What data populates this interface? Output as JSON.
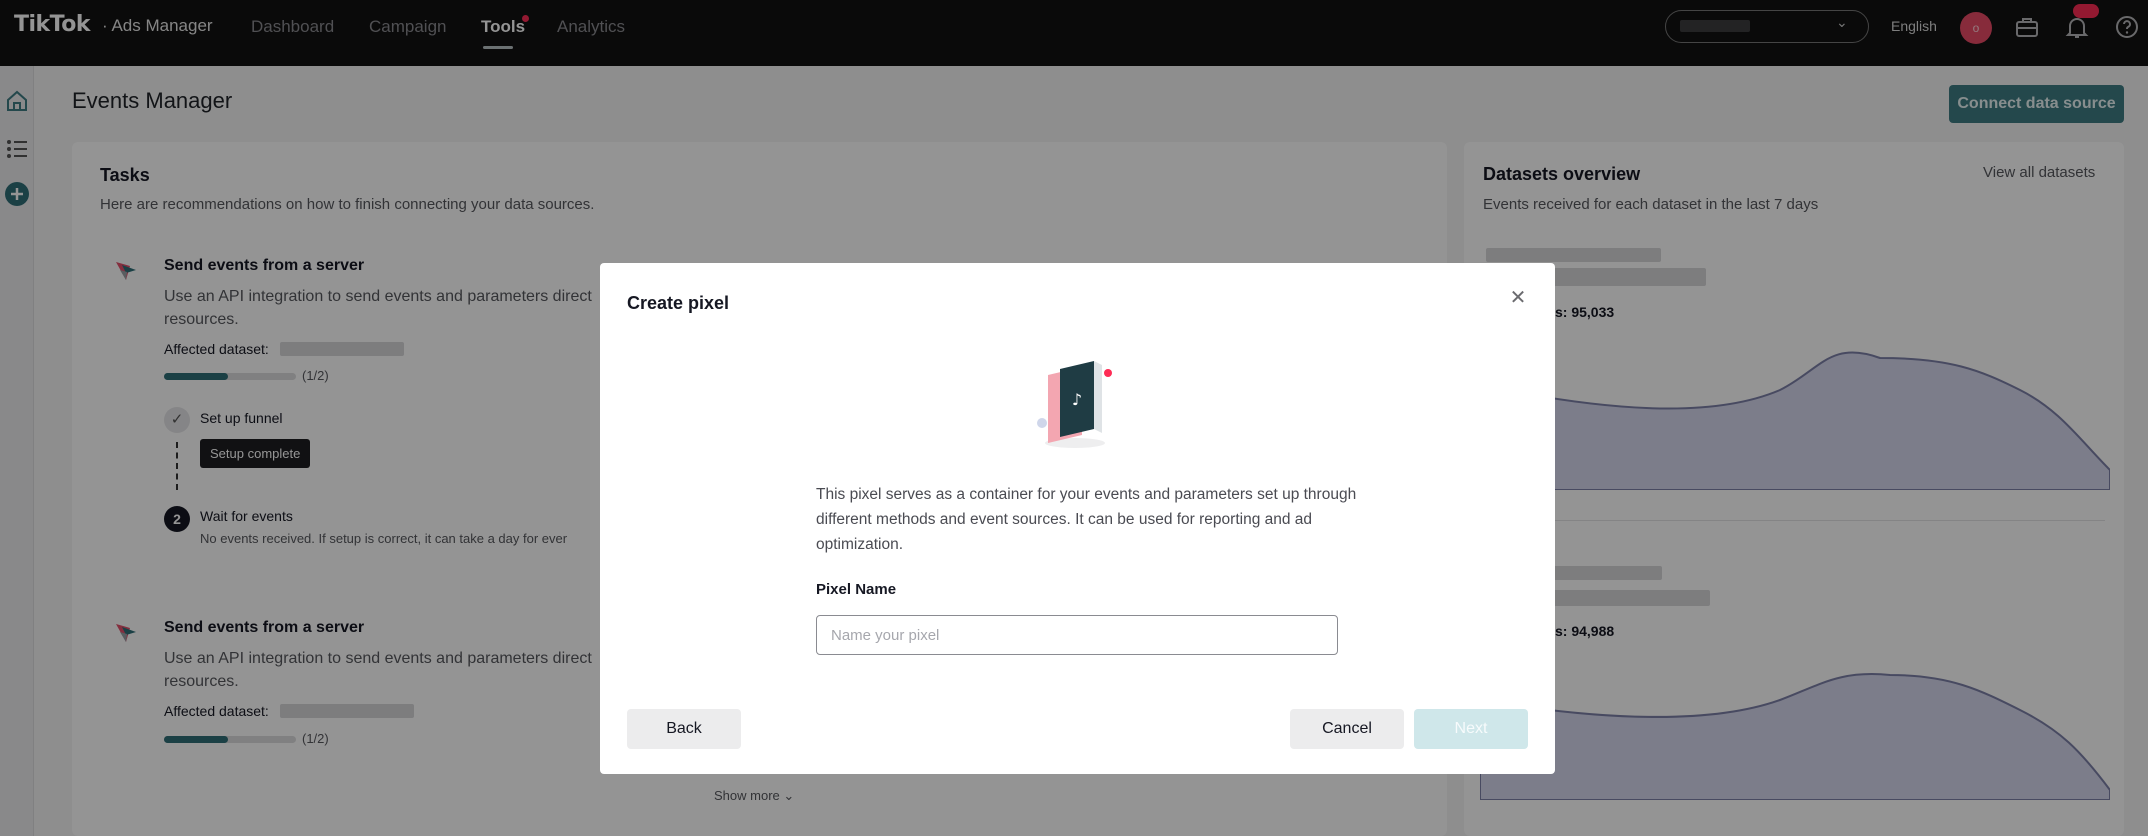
{
  "header": {
    "logo": "TikTok",
    "logo_suffix": "· Ads Manager",
    "nav": [
      {
        "label": "Dashboard",
        "active": false
      },
      {
        "label": "Campaign",
        "active": false
      },
      {
        "label": "Tools",
        "active": true
      },
      {
        "label": "Analytics",
        "active": false
      }
    ],
    "language": "English",
    "avatar_initial": "o"
  },
  "page": {
    "title": "Events Manager",
    "connect_button": "Connect data source"
  },
  "tasks": {
    "title": "Tasks",
    "subtitle": "Here are recommendations on how to finish connecting your data sources.",
    "items": [
      {
        "title": "Send events from a server",
        "description": "Use an API integration to send events and parameters direct",
        "description_cont": "resources.",
        "affected_label": "Affected dataset:",
        "progress_text": "(1/2)",
        "progress_fraction": 0.5
      },
      {
        "title": "Send events from a server",
        "description": "Use an API integration to send events and parameters direct",
        "description_cont": "resources.",
        "affected_label": "Affected dataset:",
        "progress_text": "(1/2)",
        "progress_fraction": 0.5
      }
    ],
    "steps": {
      "step1_label": "Set up funnel",
      "setup_tag": "Setup complete",
      "step2_number": "2",
      "step2_label": "Wait for events",
      "step2_note": "No events received. If setup is correct, it can take a day for ever"
    },
    "show_more": "Show more ⌄"
  },
  "datasets": {
    "title": "Datasets overview",
    "view_all": "View all datasets",
    "subtitle": "Events received for each dataset in the last 7 days",
    "metrics": [
      "s: 95,033",
      "s: 94,988"
    ]
  },
  "modal": {
    "title": "Create pixel",
    "description": "This pixel serves as a container for your events and parameters set up through different methods and event sources. It can be used for reporting and ad optimization.",
    "field_label": "Pixel Name",
    "input_placeholder": "Name your pixel",
    "input_value": "",
    "back": "Back",
    "cancel": "Cancel",
    "next": "Next"
  },
  "colors": {
    "accent": "#3f7c83",
    "brand_red": "#fe2c55",
    "next_disabled": "#cfe7ea"
  }
}
